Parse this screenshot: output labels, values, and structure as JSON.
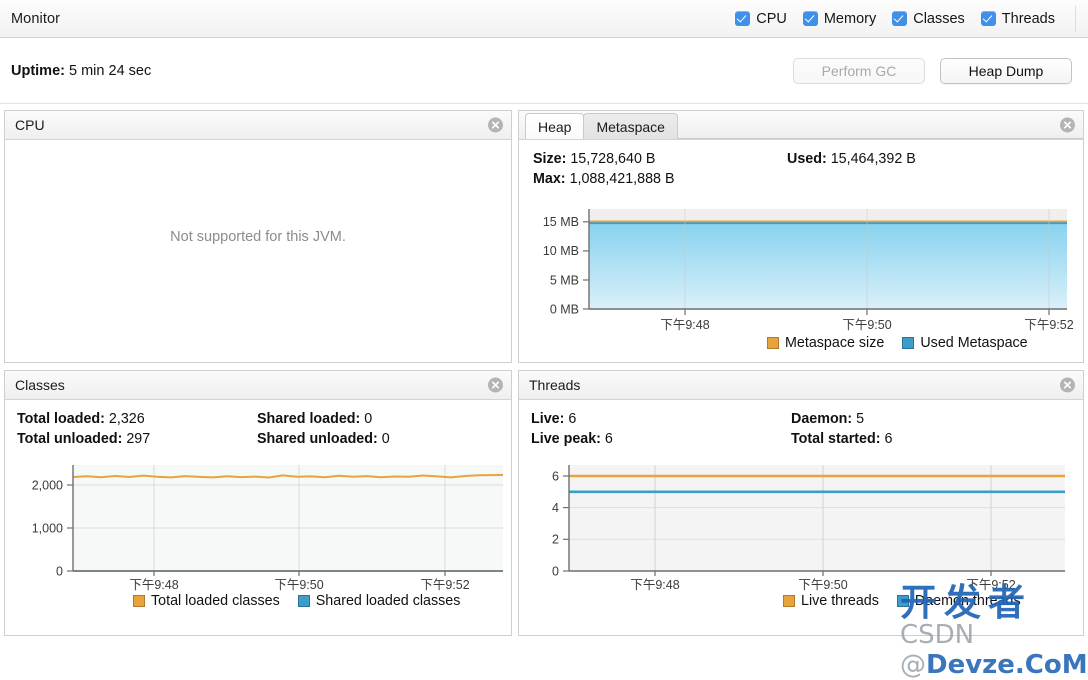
{
  "toolbar": {
    "title": "Monitor",
    "checkboxes": [
      {
        "label": "CPU",
        "checked": true
      },
      {
        "label": "Memory",
        "checked": true
      },
      {
        "label": "Classes",
        "checked": true
      },
      {
        "label": "Threads",
        "checked": true
      }
    ]
  },
  "uptime": {
    "label": "Uptime:",
    "value": "5 min 24 sec"
  },
  "buttons": {
    "perform_gc": "Perform GC",
    "heap_dump": "Heap Dump"
  },
  "panels": {
    "cpu": {
      "title": "CPU",
      "message": "Not supported for this JVM.",
      "close_icon": "close-icon"
    },
    "memory": {
      "tabs": [
        {
          "label": "Heap",
          "active": false
        },
        {
          "label": "Metaspace",
          "active": true
        }
      ],
      "stats": [
        {
          "label": "Size:",
          "value": "15,728,640 B"
        },
        {
          "label": "Max:",
          "value": "1,088,421,888 B"
        },
        {
          "label": "Used:",
          "value": "15,464,392 B"
        }
      ],
      "close_icon": "close-icon"
    },
    "classes": {
      "title": "Classes",
      "stats": [
        {
          "label": "Total loaded:",
          "value": "2,326"
        },
        {
          "label": "Total unloaded:",
          "value": "297"
        },
        {
          "label": "Shared loaded:",
          "value": "0"
        },
        {
          "label": "Shared unloaded:",
          "value": "0"
        }
      ],
      "close_icon": "close-icon"
    },
    "threads": {
      "title": "Threads",
      "stats": [
        {
          "label": "Live:",
          "value": "6"
        },
        {
          "label": "Live peak:",
          "value": "6"
        },
        {
          "label": "Daemon:",
          "value": "5"
        },
        {
          "label": "Total started:",
          "value": "6"
        }
      ],
      "close_icon": "close-icon"
    }
  },
  "colors": {
    "orange": "#e8a33d",
    "blue": "#3d9cc8",
    "blue_fill_top": "#8fd4ec",
    "blue_fill_bottom": "#d8eef9",
    "checkbox": "#3e90e8",
    "watermark": "#1f63b4"
  },
  "watermark": {
    "main": "开发者",
    "sub_prefix": "CSDN @",
    "sub": "Devze.CoM"
  },
  "chart_data": [
    {
      "id": "metaspace",
      "type": "area",
      "title": "Metaspace",
      "xlabel": "",
      "ylabel": "",
      "ylim": [
        0,
        17.2
      ],
      "yticks": [
        0,
        5,
        10,
        15
      ],
      "ytick_labels": [
        "0 MB",
        "5 MB",
        "10 MB",
        "15 MB"
      ],
      "xticks": [
        "下午9:48",
        "下午9:50",
        "下午9:52"
      ],
      "grid": true,
      "legend_position": "bottom-right",
      "series": [
        {
          "name": "Metaspace size",
          "color": "#e8a33d",
          "values": [
            15.0,
            15.0,
            15.0,
            15.0,
            15.0,
            15.0,
            15.0,
            15.0,
            15.0,
            15.0,
            15.0,
            15.0,
            15.0,
            15.0,
            15.0,
            15.0,
            15.0,
            15.0,
            15.0,
            15.0,
            15.0
          ]
        },
        {
          "name": "Used Metaspace",
          "color": "#3d9cc8",
          "values": [
            14.7,
            14.7,
            14.7,
            14.74,
            14.74,
            14.74,
            14.74,
            14.75,
            14.75,
            14.75,
            14.75,
            14.75,
            14.75,
            14.75,
            14.75,
            14.75,
            14.75,
            14.75,
            14.75,
            14.75,
            14.75
          ]
        }
      ]
    },
    {
      "id": "classes",
      "type": "line",
      "title": "Classes",
      "xlabel": "",
      "ylabel": "",
      "ylim": [
        0,
        2600
      ],
      "yticks": [
        0,
        1000,
        2000
      ],
      "ytick_labels": [
        "0",
        "1,000",
        "2,000"
      ],
      "xticks": [
        "下午9:48",
        "下午9:50",
        "下午9:52"
      ],
      "grid": true,
      "legend_position": "bottom-center",
      "series": [
        {
          "name": "Total loaded classes",
          "color": "#e8a33d",
          "values": [
            2290,
            2300,
            2295,
            2305,
            2298,
            2310,
            2300,
            2296,
            2308,
            2302,
            2297,
            2306,
            2299,
            2304,
            2295,
            2312,
            2300,
            2303,
            2297,
            2309,
            2301,
            2306,
            2298,
            2304,
            2300,
            2311,
            2302,
            2296,
            2307,
            2326
          ]
        },
        {
          "name": "Shared loaded classes",
          "color": "#3d9cc8",
          "values": [
            0,
            0,
            0,
            0,
            0,
            0,
            0,
            0,
            0,
            0,
            0,
            0,
            0,
            0,
            0,
            0,
            0,
            0,
            0,
            0,
            0,
            0,
            0,
            0,
            0,
            0,
            0,
            0,
            0,
            0
          ]
        }
      ]
    },
    {
      "id": "threads",
      "type": "line",
      "title": "Threads",
      "xlabel": "",
      "ylabel": "",
      "ylim": [
        0,
        6.6
      ],
      "yticks": [
        0,
        2,
        4,
        6
      ],
      "ytick_labels": [
        "0",
        "2",
        "4",
        "6"
      ],
      "xticks": [
        "下午9:48",
        "下午9:50",
        "下午9:52"
      ],
      "grid": true,
      "legend_position": "bottom-center",
      "series": [
        {
          "name": "Live threads",
          "color": "#e8a33d",
          "values": [
            6,
            6,
            6,
            6,
            6,
            6,
            6,
            6,
            6,
            6,
            6,
            6,
            6,
            6,
            6,
            6,
            6,
            6,
            6,
            6,
            6
          ]
        },
        {
          "name": "Daemon threads",
          "color": "#3d9cc8",
          "values": [
            5,
            5,
            5,
            5,
            5,
            5,
            5,
            5,
            5,
            5,
            5,
            5,
            5,
            5,
            5,
            5,
            5,
            5,
            5,
            5,
            5
          ]
        }
      ]
    }
  ]
}
